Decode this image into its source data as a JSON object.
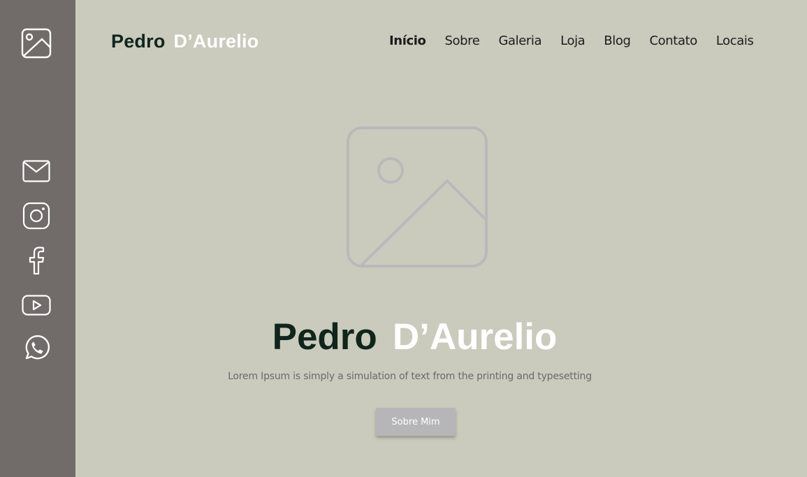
{
  "sidebar": {
    "icons": [
      "image-icon",
      "mail-icon",
      "instagram-icon",
      "facebook-icon",
      "youtube-icon",
      "whatsapp-icon"
    ]
  },
  "header": {
    "logo_first": "Pedro",
    "logo_last": "D’Aurelio",
    "nav": [
      "Início",
      "Sobre",
      "Galeria",
      "Loja",
      "Blog",
      "Contato",
      "Locais"
    ]
  },
  "hero": {
    "title_first": "Pedro",
    "title_last": "D’Aurelio",
    "subtitle": "Lorem Ipsum is simply a simulation of text from the printing and typesetting",
    "cta_label": "Sobre Mim"
  },
  "colors": {
    "background": "#cacbbd",
    "sidebar": "#716b6a",
    "dark_text": "#10251c",
    "button": "#b6b6b8"
  }
}
